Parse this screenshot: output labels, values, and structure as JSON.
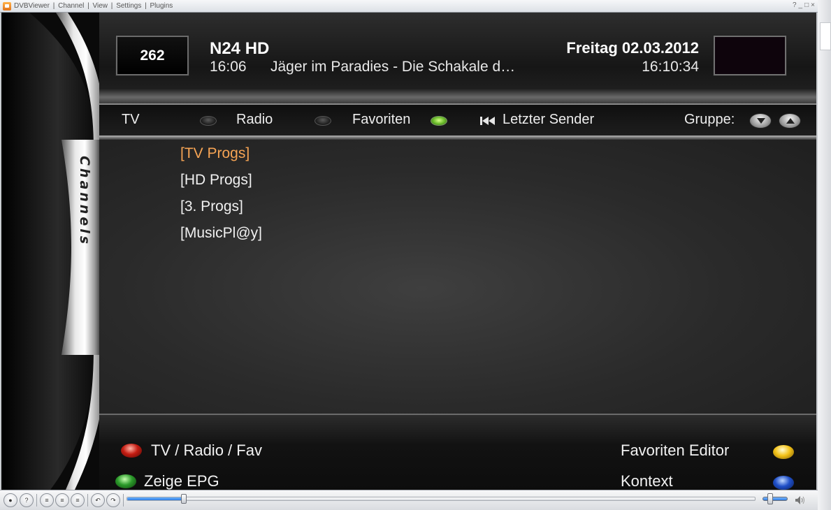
{
  "window": {
    "title": "DVBViewer",
    "menu": [
      "DVBViewer",
      "Channel",
      "View",
      "Settings",
      "Plugins"
    ],
    "controls": [
      "?",
      "_",
      "□",
      "×"
    ]
  },
  "header": {
    "channel_number": "262",
    "channel_name": "N24 HD",
    "epg_time": "16:06",
    "epg_title": "Jäger im Paradies - Die Schakale d…",
    "date": "Freitag 02.03.2012",
    "clock": "16:10:34"
  },
  "side_tab": {
    "label": "Channels"
  },
  "navbar": {
    "tv": "TV",
    "radio": "Radio",
    "favorites": "Favoriten",
    "last_channel": "Letzter Sender",
    "group": "Gruppe:"
  },
  "list": {
    "items": [
      "[TV Progs]",
      "[HD Progs]",
      "[3. Progs]",
      "[MusicPl@y]"
    ],
    "selected_index": 0
  },
  "footer": {
    "red": "TV / Radio / Fav",
    "green": "Zeige EPG",
    "yellow": "Favoriten Editor",
    "blue": "Kontext"
  },
  "toolbar": {
    "seek_progress": 0.09,
    "volume_level": 0.3
  },
  "colors": {
    "selected_item": "#f6a454",
    "red": "#c41c12",
    "green": "#2b9a2a",
    "yellow": "#f3c218",
    "blue": "#1f4fc8",
    "seek_fill": "#2e7be0"
  }
}
